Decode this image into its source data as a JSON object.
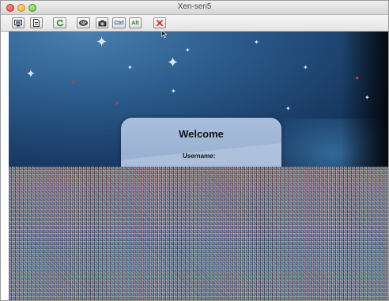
{
  "window": {
    "title": "Xen-seri5"
  },
  "toolbar": {
    "buttons": [
      {
        "name": "settings",
        "icon": "computer-settings-icon"
      },
      {
        "name": "info",
        "icon": "document-info-icon"
      },
      {
        "name": "refresh",
        "icon": "refresh-icon"
      },
      {
        "name": "send-keys",
        "icon": "keyboard-icon"
      },
      {
        "name": "screenshot",
        "icon": "camera-icon"
      },
      {
        "name": "ctrl",
        "label": "Ctrl"
      },
      {
        "name": "alt",
        "label": "Alt"
      },
      {
        "name": "disconnect",
        "icon": "close-icon",
        "color": "#d81e1e"
      }
    ]
  },
  "remote_screen": {
    "welcome_title": "Welcome",
    "username_label": "Username:"
  }
}
